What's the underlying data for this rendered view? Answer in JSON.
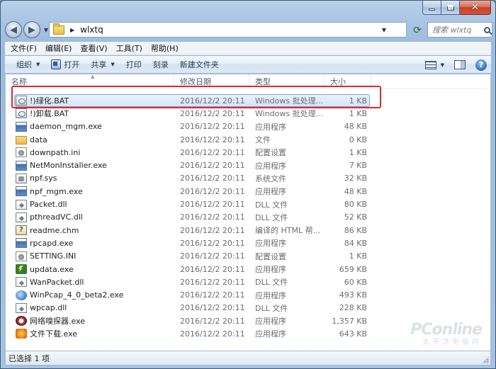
{
  "address": {
    "path": "wlxtq"
  },
  "search": {
    "placeholder": "搜索 wlxtq"
  },
  "menu": [
    "文件(F)",
    "编辑(E)",
    "查看(V)",
    "工具(T)",
    "帮助(H)"
  ],
  "commands": {
    "organize": "组织",
    "open": "打开",
    "share": "共享",
    "print": "打印",
    "burn": "刻录",
    "new_folder": "新建文件夹"
  },
  "columns": {
    "name": "名称",
    "date": "修改日期",
    "type": "类型",
    "size": "大小"
  },
  "files": [
    {
      "name": "!)绿化.BAT",
      "date": "2016/12/2 20:11",
      "type": "Windows 批处理...",
      "size": "1 KB",
      "icon": "bat-icon",
      "selected": true
    },
    {
      "name": "!)卸载.BAT",
      "date": "2016/12/2 20:11",
      "type": "Windows 批处理...",
      "size": "1 KB",
      "icon": "bat-icon"
    },
    {
      "name": "daemon_mgm.exe",
      "date": "2016/12/2 20:11",
      "type": "应用程序",
      "size": "48 KB",
      "icon": "exe-icon"
    },
    {
      "name": "data",
      "date": "2016/12/2 20:11",
      "type": "文件",
      "size": "0 KB",
      "icon": "file-icon"
    },
    {
      "name": "downpath.ini",
      "date": "2016/12/2 20:11",
      "type": "配置设置",
      "size": "1 KB",
      "icon": "ini-icon"
    },
    {
      "name": "NetMonInstaller.exe",
      "date": "2016/12/2 20:11",
      "type": "应用程序",
      "size": "7 KB",
      "icon": "exe-icon"
    },
    {
      "name": "npf.sys",
      "date": "2016/12/2 20:11",
      "type": "系统文件",
      "size": "32 KB",
      "icon": "sys-icon"
    },
    {
      "name": "npf_mgm.exe",
      "date": "2016/12/2 20:11",
      "type": "应用程序",
      "size": "48 KB",
      "icon": "exe-icon"
    },
    {
      "name": "Packet.dll",
      "date": "2016/12/2 20:11",
      "type": "DLL 文件",
      "size": "80 KB",
      "icon": "dll-icon"
    },
    {
      "name": "pthreadVC.dll",
      "date": "2016/12/2 20:11",
      "type": "DLL 文件",
      "size": "52 KB",
      "icon": "dll-icon"
    },
    {
      "name": "readme.chm",
      "date": "2016/12/2 20:11",
      "type": "编译的 HTML 帮...",
      "size": "86 KB",
      "icon": "chm-icon"
    },
    {
      "name": "rpcapd.exe",
      "date": "2016/12/2 20:11",
      "type": "应用程序",
      "size": "84 KB",
      "icon": "exe-icon"
    },
    {
      "name": "SETTING.INI",
      "date": "2016/12/2 20:11",
      "type": "配置设置",
      "size": "1 KB",
      "icon": "ini-icon"
    },
    {
      "name": "updata.exe",
      "date": "2016/12/2 20:11",
      "type": "应用程序",
      "size": "659 KB",
      "icon": "update-icon"
    },
    {
      "name": "WanPacket.dll",
      "date": "2016/12/2 20:11",
      "type": "DLL 文件",
      "size": "60 KB",
      "icon": "dll-icon"
    },
    {
      "name": "WinPcap_4_0_beta2.exe",
      "date": "2016/12/2 20:11",
      "type": "应用程序",
      "size": "493 KB",
      "icon": "winpcap-icon"
    },
    {
      "name": "wpcap.dll",
      "date": "2016/12/2 20:11",
      "type": "DLL 文件",
      "size": "228 KB",
      "icon": "dll-icon"
    },
    {
      "name": "网络嗅探器.exe",
      "date": "2016/12/2 20:11",
      "type": "应用程序",
      "size": "1,357 KB",
      "icon": "sniffer-icon"
    },
    {
      "name": "文件下载.exe",
      "date": "2016/12/2 20:11",
      "type": "应用程序",
      "size": "643 KB",
      "icon": "download-icon"
    }
  ],
  "status": {
    "text": "已选择 1 项"
  },
  "watermark": {
    "logo": "PConline",
    "sub": "太平洋电脑网"
  },
  "colors": {
    "highlight_box": "#e4262a",
    "selection": "#d4e5fa"
  }
}
